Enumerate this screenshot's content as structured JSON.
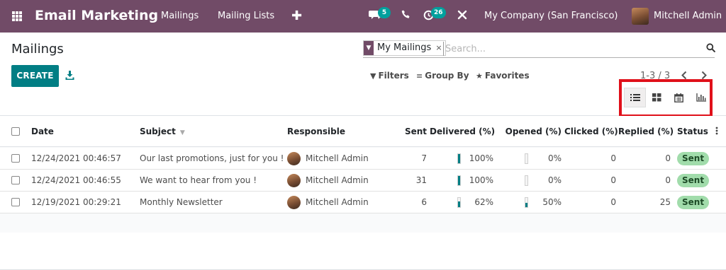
{
  "app": {
    "title": "Email Marketing",
    "menu": [
      "Mailings",
      "Mailing Lists"
    ],
    "new_menu_icon": "plus-icon",
    "messages_badge": "5",
    "activities_badge": "26",
    "company": "My Company (San Francisco)",
    "user": "Mitchell Admin"
  },
  "page": {
    "breadcrumb": "Mailings",
    "create_label": "CREATE"
  },
  "search": {
    "facet": "My Mailings",
    "placeholder": "Search...",
    "filters_label": "Filters",
    "group_by_label": "Group By",
    "favorites_label": "Favorites"
  },
  "pager": {
    "value": "1-3 / 3"
  },
  "views": {
    "items": [
      "list-view-icon",
      "kanban-view-icon",
      "calendar-view-icon",
      "graph-view-icon"
    ],
    "active": "list-view-icon",
    "highlight_color": "#e0101a"
  },
  "table": {
    "columns": [
      "Date",
      "Subject",
      "Responsible",
      "Sent",
      "Delivered (%)",
      "Opened (%)",
      "Clicked (%)",
      "Replied (%)",
      "Status"
    ],
    "rows": [
      {
        "date": "12/24/2021 00:46:57",
        "subject": "Our last promotions, just for you !",
        "responsible": "Mitchell Admin",
        "sent": "7",
        "delivered": "100%",
        "delivered_ratio": 1.0,
        "opened": "0%",
        "opened_ratio": 0.0,
        "clicked": "0",
        "replied": "0",
        "status": "Sent"
      },
      {
        "date": "12/24/2021 00:46:55",
        "subject": "We want to hear from you !",
        "responsible": "Mitchell Admin",
        "sent": "31",
        "delivered": "100%",
        "delivered_ratio": 1.0,
        "opened": "0%",
        "opened_ratio": 0.0,
        "clicked": "0",
        "replied": "0",
        "status": "Sent"
      },
      {
        "date": "12/19/2021 00:29:21",
        "subject": "Monthly Newsletter",
        "responsible": "Mitchell Admin",
        "sent": "6",
        "delivered": "62%",
        "delivered_ratio": 0.62,
        "opened": "50%",
        "opened_ratio": 0.5,
        "clicked": "0",
        "replied": "25",
        "status": "Sent"
      }
    ]
  },
  "colors": {
    "navbar": "#714b67",
    "primary": "#017e84",
    "badge": "#00a09d",
    "status_sent": "#a1dcab"
  }
}
